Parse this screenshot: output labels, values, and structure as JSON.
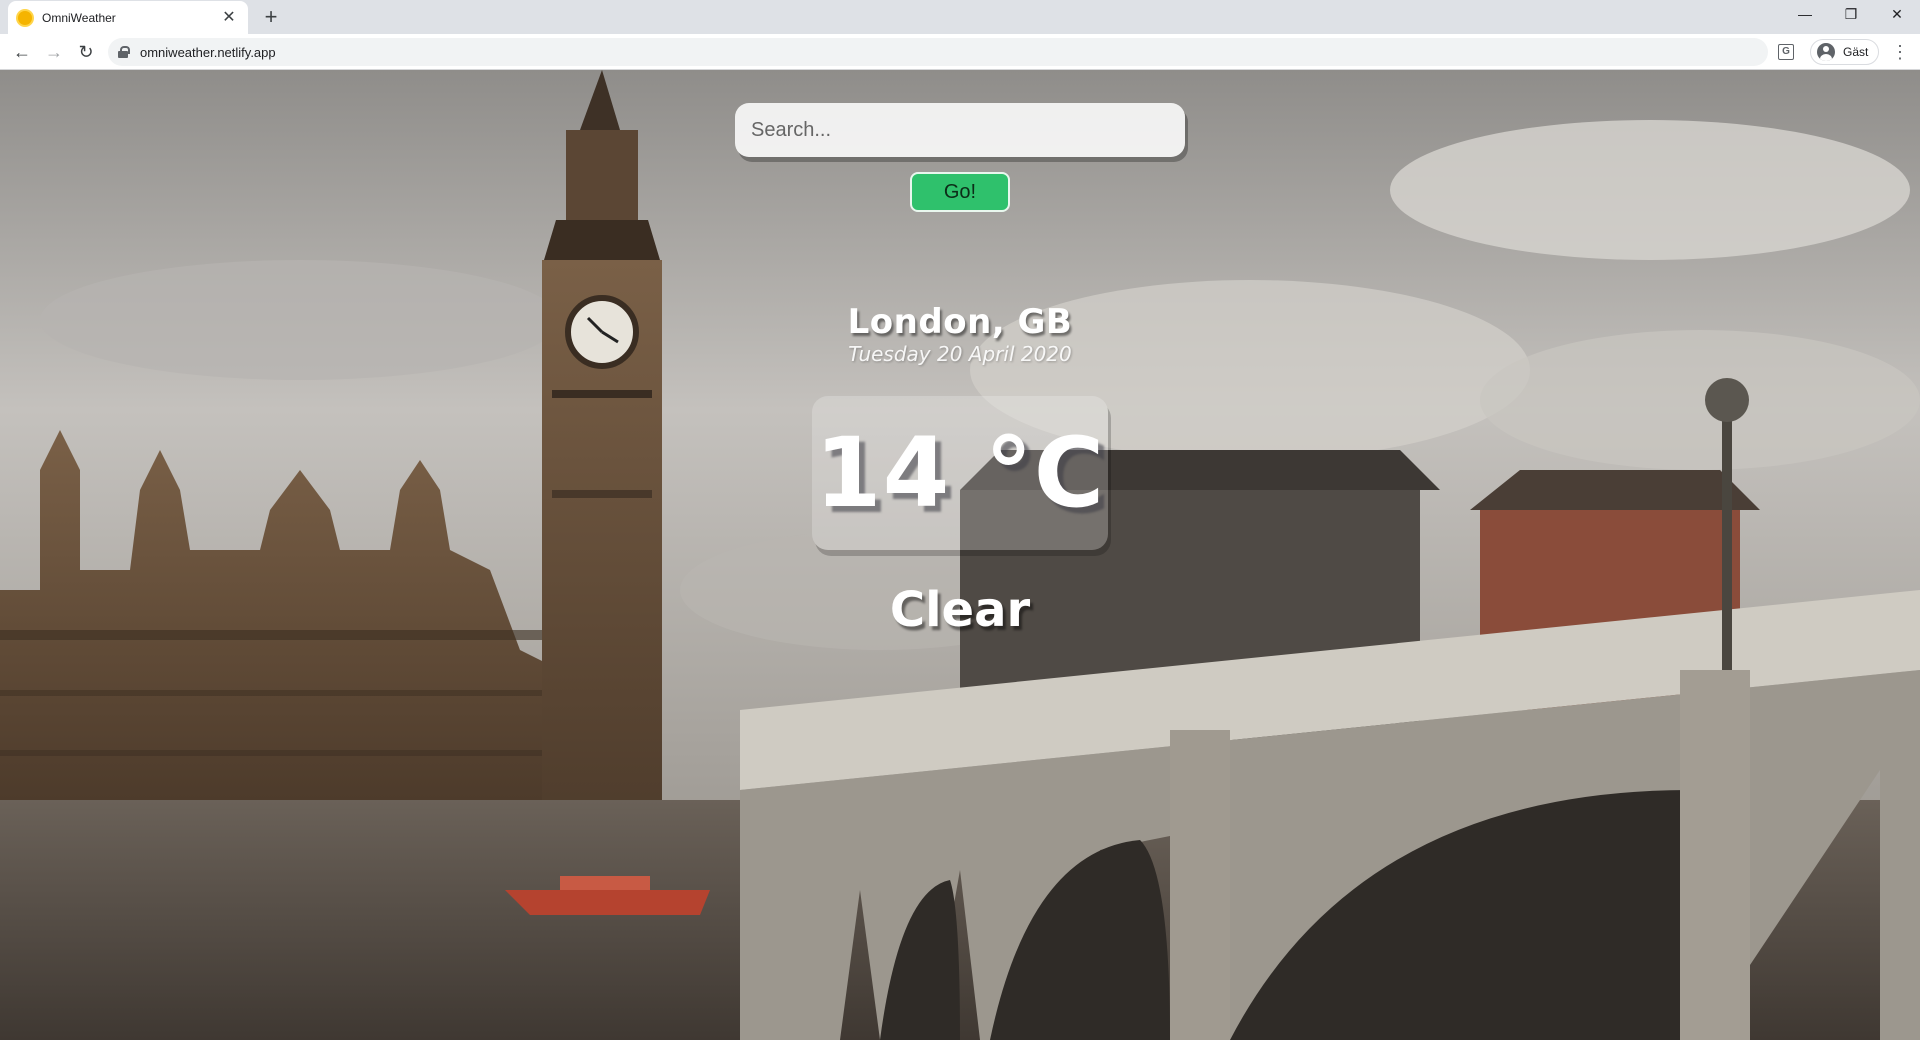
{
  "browser": {
    "tab": {
      "title": "OmniWeather",
      "favicon": "sun-icon",
      "close": "✕"
    },
    "new_tab": "+",
    "window_controls": {
      "minimize": "—",
      "maximize": "❐",
      "close": "✕"
    },
    "nav": {
      "back": "←",
      "forward": "→",
      "reload": "↻"
    },
    "url": "omniweather.netlify.app",
    "translate": "G",
    "profile_label": "Gäst",
    "menu": "⋮"
  },
  "app": {
    "search": {
      "placeholder": "Search...",
      "value": ""
    },
    "go_label": "Go!",
    "location": "London, GB",
    "date": "Tuesday 20 April 2020",
    "temperature": "14 °C",
    "condition": "Clear",
    "background_image": "london-westminster-photo"
  },
  "colors": {
    "go_button": "#2fc16c",
    "sky": "#b9b6b2",
    "stone": "#7a5e42",
    "bridge": "#cfcbc2",
    "water": "#5e554b"
  }
}
